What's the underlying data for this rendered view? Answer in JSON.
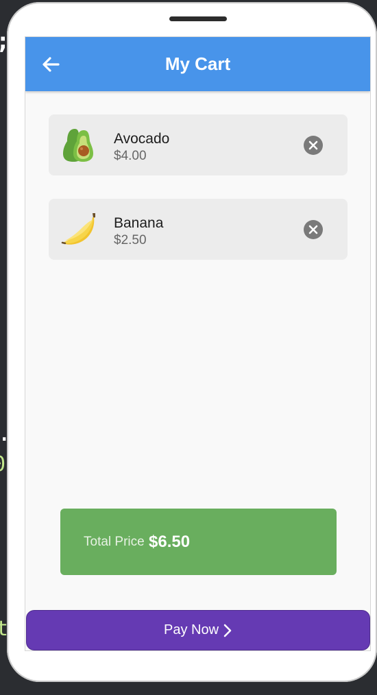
{
  "appbar": {
    "title": "My Cart",
    "back_icon": "arrow-left-icon",
    "color": "#4894ea"
  },
  "cart": {
    "items": [
      {
        "name": "Avocado",
        "price": "$4.00",
        "icon": "avocado-icon",
        "remove_icon": "close-circle-icon"
      },
      {
        "name": "Banana",
        "price": "$2.50",
        "icon": "banana-icon",
        "remove_icon": "close-circle-icon"
      }
    ]
  },
  "total": {
    "label": "Total Price",
    "value": "$6.50",
    "color": "#69ae5e"
  },
  "pay": {
    "label": "Pay Now",
    "icon": "chevron-right-icon",
    "color": "#653ab3"
  }
}
